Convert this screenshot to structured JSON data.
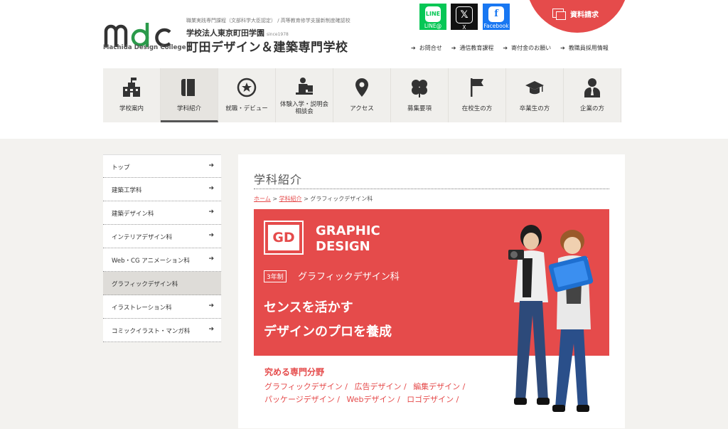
{
  "logo": {
    "text": "mdc",
    "sub": "Machida Design College"
  },
  "school": {
    "note": "職業実践専門課程（文部科学大臣認定） / 高等教育修学支援新制度確認校",
    "corp": "学校法人東京町田学園",
    "since": "since1978",
    "name": "町田デザイン＆建築専門学校"
  },
  "sns": {
    "line": "LINE@",
    "x": "X",
    "facebook": "Facebook"
  },
  "doc_request": "資料請求",
  "sublinks": [
    "お問合せ",
    "通信教育課程",
    "寄付金のお願い",
    "教職員採用情報"
  ],
  "gnav": [
    {
      "label": "学校案内",
      "icon": "school-icon"
    },
    {
      "label": "学科紹介",
      "icon": "book-icon"
    },
    {
      "label": "就職・デビュー",
      "icon": "star-icon"
    },
    {
      "label": "体験入学・説明会\n相談会",
      "icon": "lecture-icon"
    },
    {
      "label": "アクセス",
      "icon": "map-pin-icon"
    },
    {
      "label": "募集要項",
      "icon": "clover-icon"
    },
    {
      "label": "在校生の方",
      "icon": "flag-icon"
    },
    {
      "label": "卒業生の方",
      "icon": "graduation-cap-icon"
    },
    {
      "label": "企業の方",
      "icon": "businessman-icon"
    }
  ],
  "sidebar": [
    "トップ",
    "建築工学科",
    "建築デザイン科",
    "インテリアデザイン科",
    "Web・CG アニメーション科",
    "グラフィックデザイン科",
    "イラストレーション科",
    "コミックイラスト・マンガ科"
  ],
  "page_title": "学科紹介",
  "breadcrumb": {
    "home": "ホーム",
    "dept": "学科紹介",
    "current": "グラフィックデザイン科",
    "sep": ">"
  },
  "hero": {
    "badge": "GD",
    "title_line1": "GRAPHIC",
    "title_line2": "DESIGN",
    "term": "3年制",
    "course": "グラフィックデザイン科",
    "tagline1": "センスを活かす",
    "tagline2": "デザインのプロを養成"
  },
  "specialties": {
    "title": "究める専門分野",
    "row1": [
      "グラフィックデザイン /",
      "広告デザイン /",
      "編集デザイン /"
    ],
    "row2": [
      "パッケージデザイン /",
      "Webデザイン /",
      "ロゴデザイン /"
    ]
  },
  "colors": {
    "accent": "#e54b4b",
    "nav_bg": "#f0efec",
    "page_bg": "#f3f2ef"
  }
}
